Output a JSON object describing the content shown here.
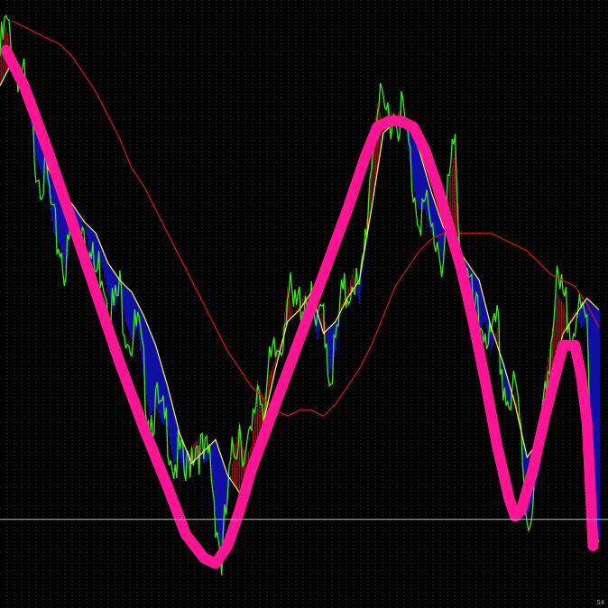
{
  "chart_data": {
    "type": "line",
    "title": "",
    "xlabel": "",
    "ylabel": "",
    "grid": true,
    "xlim": [
      0,
      100
    ],
    "ylim": [
      0,
      100
    ],
    "colors": {
      "background": "#000000",
      "grid": "#5a5a5a",
      "price": "#33ee11",
      "fast_ma": "#ffff33",
      "slow_ma": "#dd1111",
      "fill_down": "#1010aa",
      "fill_up": "#cc2222",
      "trend": "#ff1493",
      "baseline": "#aebfcf"
    },
    "horizontal_line": 13.5,
    "corner_text": "54",
    "series": [
      {
        "key": "price",
        "values": [
          [
            0,
            92
          ],
          [
            1,
            97
          ],
          [
            2,
            93
          ],
          [
            3,
            90
          ],
          [
            4,
            87
          ],
          [
            5,
            82
          ],
          [
            6,
            75
          ],
          [
            7,
            72
          ],
          [
            8,
            70
          ],
          [
            9,
            62
          ],
          [
            10,
            60
          ],
          [
            11,
            56
          ],
          [
            12,
            63
          ],
          [
            13,
            60
          ],
          [
            14,
            65
          ],
          [
            15,
            58
          ],
          [
            16,
            55
          ],
          [
            17,
            57
          ],
          [
            18,
            52
          ],
          [
            19,
            49
          ],
          [
            20,
            52
          ],
          [
            21,
            47
          ],
          [
            22,
            44
          ],
          [
            23,
            46
          ],
          [
            24,
            38
          ],
          [
            25,
            31
          ],
          [
            26,
            33
          ],
          [
            27,
            30
          ],
          [
            28,
            29
          ],
          [
            29,
            23
          ],
          [
            30,
            24
          ],
          [
            31,
            20
          ],
          [
            32,
            26
          ],
          [
            33,
            27
          ],
          [
            34,
            23
          ],
          [
            35,
            24
          ],
          [
            36,
            15
          ],
          [
            37,
            6
          ],
          [
            38,
            17
          ],
          [
            39,
            25
          ],
          [
            40,
            30
          ],
          [
            41,
            24
          ],
          [
            42,
            26
          ],
          [
            43,
            37
          ],
          [
            44,
            34
          ],
          [
            45,
            38
          ],
          [
            46,
            41
          ],
          [
            47,
            44
          ],
          [
            48,
            53
          ],
          [
            49,
            48
          ],
          [
            50,
            50
          ],
          [
            51,
            52
          ],
          [
            52,
            49
          ],
          [
            53,
            44
          ],
          [
            54,
            50
          ],
          [
            55,
            38
          ],
          [
            56,
            42
          ],
          [
            57,
            50
          ],
          [
            58,
            52
          ],
          [
            59,
            56
          ],
          [
            60,
            50
          ],
          [
            61,
            61
          ],
          [
            62,
            75
          ],
          [
            63,
            84
          ],
          [
            64,
            81
          ],
          [
            65,
            83
          ],
          [
            66,
            82
          ],
          [
            67,
            83
          ],
          [
            68,
            78
          ],
          [
            69,
            70
          ],
          [
            70,
            66
          ],
          [
            71,
            66
          ],
          [
            72,
            62
          ],
          [
            73,
            61
          ],
          [
            74,
            57
          ],
          [
            75,
            71
          ],
          [
            76,
            76
          ],
          [
            77,
            58
          ],
          [
            78,
            54
          ],
          [
            79,
            49
          ],
          [
            80,
            46
          ],
          [
            81,
            47
          ],
          [
            82,
            42
          ],
          [
            83,
            46
          ],
          [
            84,
            37
          ],
          [
            85,
            33
          ],
          [
            86,
            35
          ],
          [
            87,
            28
          ],
          [
            88,
            14
          ],
          [
            89,
            17
          ],
          [
            90,
            22
          ],
          [
            91,
            38
          ],
          [
            92,
            44
          ],
          [
            93,
            52
          ],
          [
            94,
            50
          ],
          [
            95,
            47
          ],
          [
            96,
            49
          ],
          [
            97,
            46
          ],
          [
            98,
            47
          ],
          [
            99,
            12
          ],
          [
            100,
            10
          ]
        ]
      },
      {
        "key": "fast_ma",
        "values": [
          [
            0,
            87
          ],
          [
            2,
            91
          ],
          [
            4,
            88
          ],
          [
            6,
            82
          ],
          [
            8,
            73
          ],
          [
            10,
            69
          ],
          [
            12,
            67
          ],
          [
            14,
            64
          ],
          [
            16,
            62
          ],
          [
            18,
            57
          ],
          [
            20,
            54
          ],
          [
            22,
            52
          ],
          [
            24,
            48
          ],
          [
            26,
            43
          ],
          [
            28,
            36
          ],
          [
            30,
            28
          ],
          [
            32,
            23
          ],
          [
            34,
            25
          ],
          [
            36,
            27
          ],
          [
            38,
            21
          ],
          [
            40,
            18
          ],
          [
            42,
            22
          ],
          [
            44,
            30
          ],
          [
            46,
            39
          ],
          [
            48,
            47
          ],
          [
            50,
            49
          ],
          [
            52,
            52
          ],
          [
            54,
            45
          ],
          [
            56,
            47
          ],
          [
            58,
            51
          ],
          [
            60,
            54
          ],
          [
            62,
            66
          ],
          [
            64,
            79
          ],
          [
            66,
            81
          ],
          [
            68,
            81
          ],
          [
            70,
            76
          ],
          [
            72,
            69
          ],
          [
            74,
            63
          ],
          [
            76,
            60
          ],
          [
            78,
            57
          ],
          [
            80,
            54
          ],
          [
            82,
            46
          ],
          [
            84,
            40
          ],
          [
            86,
            33
          ],
          [
            88,
            24
          ],
          [
            90,
            27
          ],
          [
            92,
            37
          ],
          [
            94,
            45
          ],
          [
            96,
            48
          ],
          [
            98,
            51
          ],
          [
            100,
            49
          ]
        ]
      },
      {
        "key": "slow_ma",
        "values": [
          [
            2,
            98
          ],
          [
            4,
            97
          ],
          [
            6,
            96
          ],
          [
            8,
            95
          ],
          [
            10,
            94
          ],
          [
            12,
            92
          ],
          [
            14,
            89
          ],
          [
            16,
            86
          ],
          [
            18,
            82
          ],
          [
            20,
            78
          ],
          [
            22,
            73
          ],
          [
            24,
            70
          ],
          [
            26,
            66
          ],
          [
            28,
            62
          ],
          [
            30,
            58
          ],
          [
            32,
            54
          ],
          [
            34,
            50
          ],
          [
            36,
            46
          ],
          [
            38,
            42
          ],
          [
            40,
            39
          ],
          [
            42,
            36
          ],
          [
            44,
            34
          ],
          [
            46,
            32
          ],
          [
            48,
            31
          ],
          [
            50,
            32
          ],
          [
            52,
            32
          ],
          [
            54,
            31
          ],
          [
            56,
            33
          ],
          [
            58,
            36
          ],
          [
            60,
            39
          ],
          [
            62,
            43
          ],
          [
            64,
            48
          ],
          [
            66,
            53
          ],
          [
            68,
            56
          ],
          [
            70,
            59
          ],
          [
            72,
            61
          ],
          [
            74,
            62
          ],
          [
            76,
            62
          ],
          [
            78,
            62
          ],
          [
            80,
            62
          ],
          [
            82,
            62
          ],
          [
            84,
            61
          ],
          [
            86,
            60
          ],
          [
            88,
            59
          ],
          [
            90,
            57
          ],
          [
            92,
            55
          ],
          [
            94,
            54
          ],
          [
            96,
            53
          ],
          [
            98,
            50
          ],
          [
            100,
            46
          ]
        ]
      },
      {
        "key": "trend",
        "values": [
          [
            1,
            93
          ],
          [
            4,
            87
          ],
          [
            8,
            76
          ],
          [
            12,
            64
          ],
          [
            16,
            52
          ],
          [
            20,
            40
          ],
          [
            24,
            29
          ],
          [
            28,
            19
          ],
          [
            31,
            11
          ],
          [
            34,
            7
          ],
          [
            36,
            6
          ],
          [
            38,
            9
          ],
          [
            40,
            15
          ],
          [
            42,
            22
          ],
          [
            46,
            33
          ],
          [
            50,
            44
          ],
          [
            54,
            55
          ],
          [
            58,
            66
          ],
          [
            61,
            75
          ],
          [
            63,
            80
          ],
          [
            65,
            81
          ],
          [
            67,
            81
          ],
          [
            69,
            80
          ],
          [
            71,
            76
          ],
          [
            73,
            70
          ],
          [
            75,
            63
          ],
          [
            77,
            56
          ],
          [
            79,
            47
          ],
          [
            81,
            37
          ],
          [
            83,
            26
          ],
          [
            85,
            17
          ],
          [
            86,
            14
          ],
          [
            87,
            15
          ],
          [
            89,
            22
          ],
          [
            91,
            31
          ],
          [
            93,
            39
          ],
          [
            94,
            43
          ],
          [
            96,
            43
          ],
          [
            97,
            38
          ],
          [
            98,
            30
          ],
          [
            98.5,
            20
          ],
          [
            99,
            9
          ]
        ]
      }
    ]
  }
}
